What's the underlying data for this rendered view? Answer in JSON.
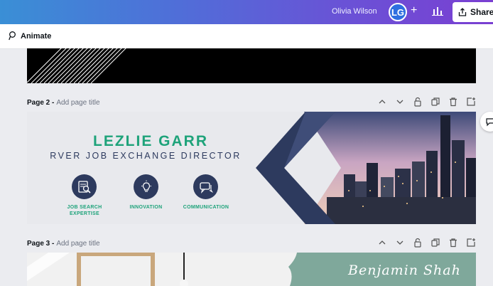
{
  "topbar": {
    "user_name": "Olivia Wilson",
    "avatar_initials": "LG",
    "share_label": "Share"
  },
  "toolbar": {
    "animate_label": "Animate"
  },
  "pages": [
    {
      "title": "Page 2 -",
      "add_title": "Add page title"
    },
    {
      "title": "Page 3 -",
      "add_title": "Add page title"
    }
  ],
  "banner": {
    "name": "LEZLIE GARR",
    "role": "RVER JOB EXCHANGE DIRECTOR",
    "skills": [
      {
        "icon": "job-search-icon",
        "label_line1": "JOB SEARCH",
        "label_line2": "EXPERTISE"
      },
      {
        "icon": "lightbulb-icon",
        "label_line1": "INNOVATION",
        "label_line2": ""
      },
      {
        "icon": "chat-icon",
        "label_line1": "COMMUNICATION",
        "label_line2": ""
      }
    ]
  },
  "page3": {
    "script_name": "Benjamin Shah"
  },
  "colors": {
    "accent_green": "#1ea37a",
    "navy": "#2d3a5e",
    "sage": "#7fa89b"
  }
}
